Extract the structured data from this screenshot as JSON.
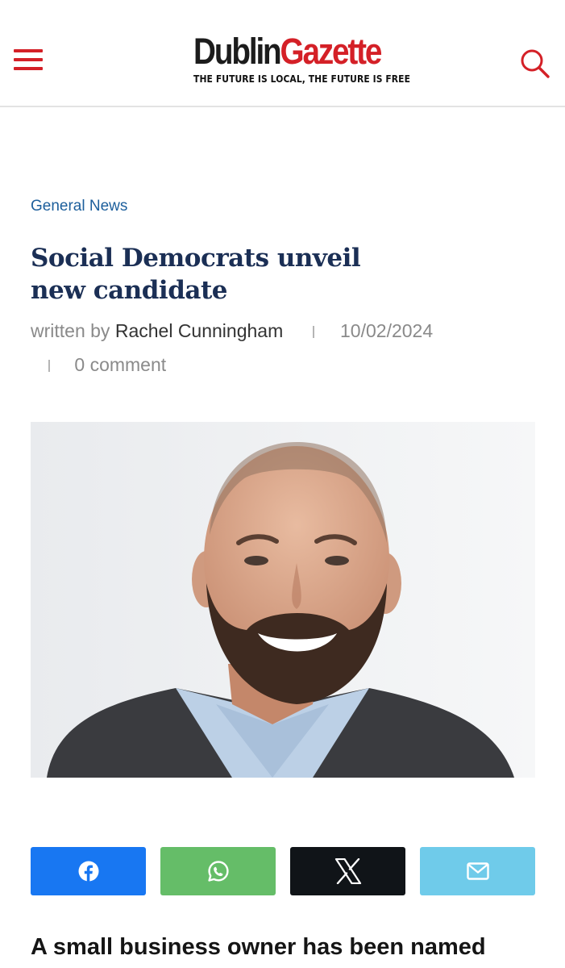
{
  "header": {
    "logo_dublin": "Dublin",
    "logo_gazette": "Gazette",
    "tagline": "THE FUTURE IS LOCAL, THE FUTURE IS FREE",
    "menu_icon": "hamburger-menu-icon",
    "search_icon": "search-icon",
    "brand_color": "#d42027"
  },
  "article": {
    "category": "General News",
    "title": "Social Democrats unveil new candidate",
    "byline_prefix": "written by",
    "author": "Rachel Cunningham",
    "date": "10/02/2024",
    "comments": "0 comment",
    "lead": "A small business owner has been named"
  },
  "share": [
    {
      "network": "facebook",
      "icon": "facebook-icon",
      "color": "#1877f2"
    },
    {
      "network": "whatsapp",
      "icon": "whatsapp-icon",
      "color": "#65bd68"
    },
    {
      "network": "x",
      "icon": "x-icon",
      "color": "#101418"
    },
    {
      "network": "email",
      "icon": "mail-icon",
      "color": "#6fcbea"
    }
  ],
  "colors": {
    "category": "#1d5f9c",
    "title": "#1b2f55"
  }
}
